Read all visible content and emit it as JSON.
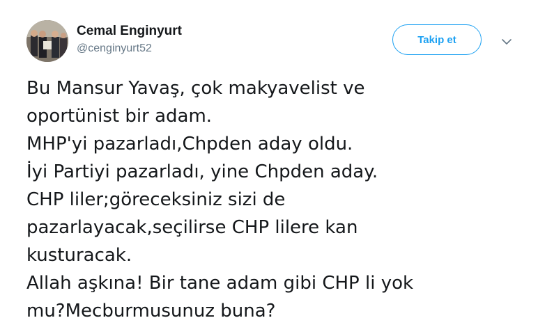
{
  "author": {
    "display_name": "Cemal Enginyurt",
    "screen_name": "@cenginyurt52",
    "avatar_icon": "profile-photo"
  },
  "follow_button": {
    "label": "Takip et"
  },
  "menu": {
    "caret_icon": "chevron-down-icon"
  },
  "tweet": {
    "lines": [
      "Bu Mansur Yavaş, çok makyavelist ve",
      "oportünist bir adam.",
      "MHP'yi pazarladı,Chpden aday oldu.",
      "İyi Partiyi pazarladı, yine Chpden aday.",
      "CHP liler;göreceksiniz sizi de",
      "pazarlayacak,seçilirse CHP lilere kan",
      "kusturacak.",
      "Allah aşkına! Bir tane adam gibi CHP li yok",
      "mu?Mecburmusunuz buna?"
    ]
  },
  "colors": {
    "accent": "#1da1f2",
    "text": "#14171a",
    "muted": "#657786"
  }
}
